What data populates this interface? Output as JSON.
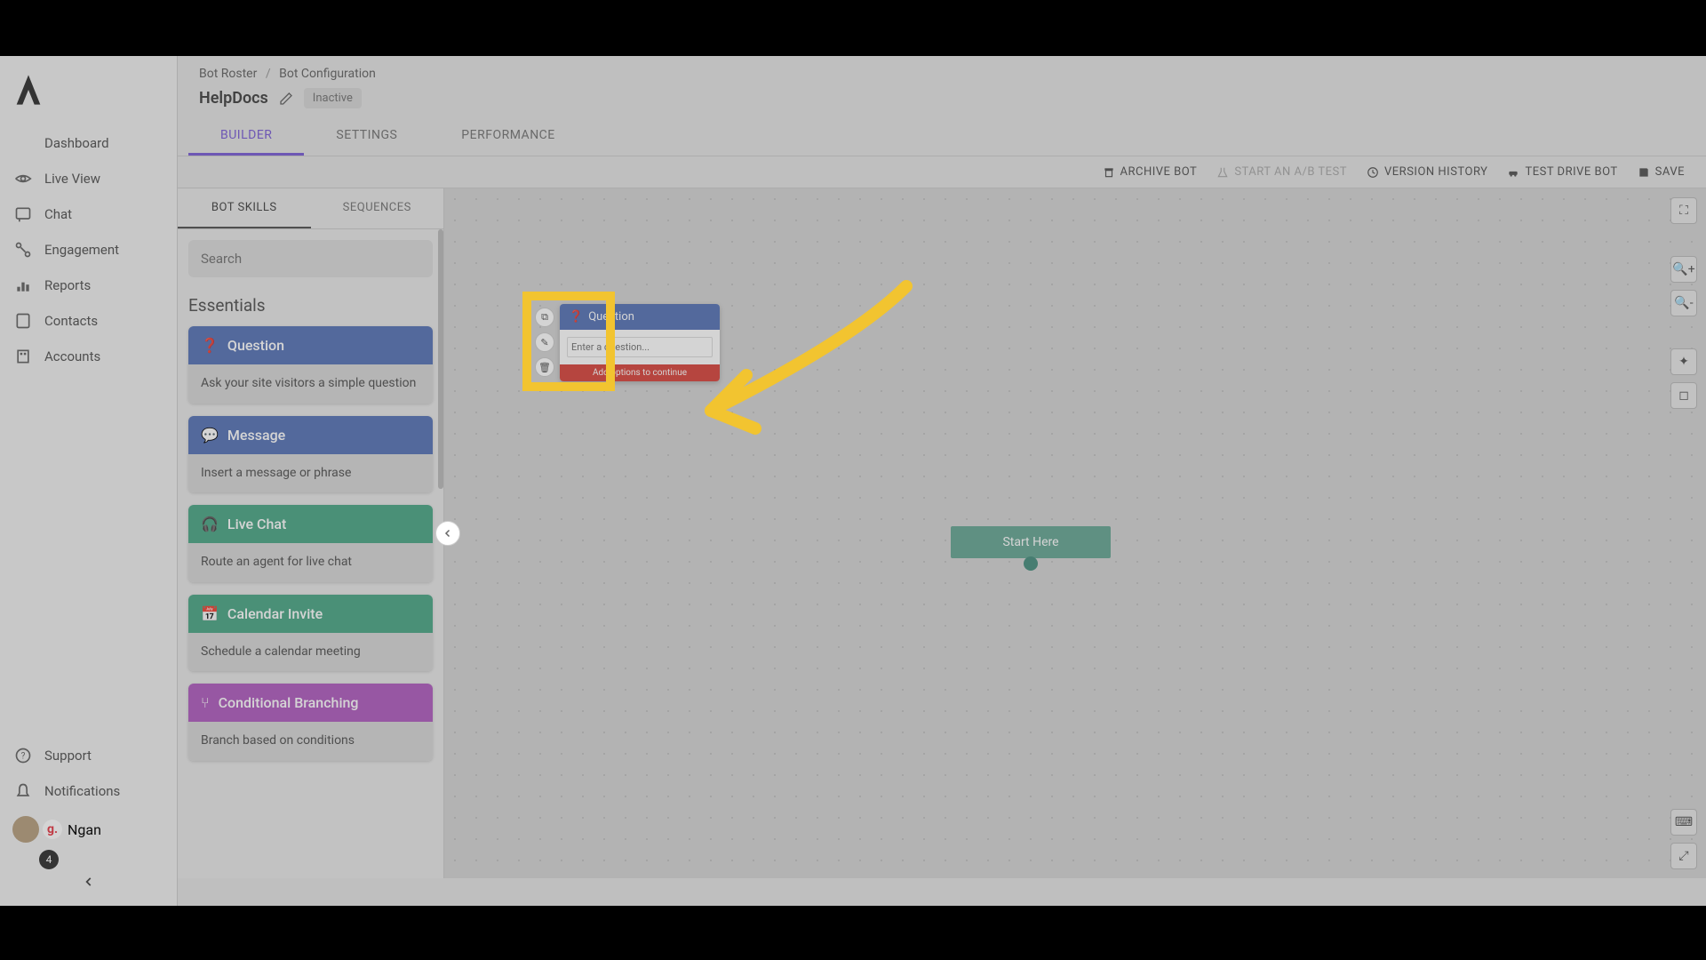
{
  "nav": {
    "items": [
      {
        "label": "Dashboard"
      },
      {
        "label": "Live View"
      },
      {
        "label": "Chat"
      },
      {
        "label": "Engagement"
      },
      {
        "label": "Reports"
      },
      {
        "label": "Contacts"
      },
      {
        "label": "Accounts"
      }
    ],
    "bottom": [
      {
        "label": "Support"
      },
      {
        "label": "Notifications"
      }
    ],
    "user": {
      "name": "Ngan",
      "badge_letter": "g.",
      "count": "4"
    }
  },
  "breadcrumb": {
    "root": "Bot Roster",
    "current": "Bot Configuration"
  },
  "bot": {
    "name": "HelpDocs",
    "status": "Inactive"
  },
  "main_tabs": [
    "BUILDER",
    "SETTINGS",
    "PERFORMANCE"
  ],
  "toolbar": {
    "archive": "ARCHIVE BOT",
    "ab_test": "START AN A/B TEST",
    "history": "VERSION HISTORY",
    "test_drive": "TEST DRIVE BOT",
    "save": "SAVE"
  },
  "skills_tabs": [
    "BOT SKILLS",
    "SEQUENCES"
  ],
  "search_placeholder": "Search",
  "section_title": "Essentials",
  "skills": [
    {
      "title": "Question",
      "desc": "Ask your site visitors a simple question",
      "color": "c-blue",
      "icon": "?"
    },
    {
      "title": "Message",
      "desc": "Insert a message or phrase",
      "color": "c-blue",
      "icon": "💬"
    },
    {
      "title": "Live Chat",
      "desc": "Route an agent for live chat",
      "color": "c-green",
      "icon": "🎧"
    },
    {
      "title": "Calendar Invite",
      "desc": "Schedule a calendar meeting",
      "color": "c-green",
      "icon": "📅"
    },
    {
      "title": "Conditional Branching",
      "desc": "Branch based on conditions",
      "color": "c-purple",
      "icon": "⑂"
    }
  ],
  "canvas": {
    "start_label": "Start Here",
    "node": {
      "title": "Question",
      "placeholder": "Enter a question...",
      "warning": "Add options to continue"
    }
  }
}
